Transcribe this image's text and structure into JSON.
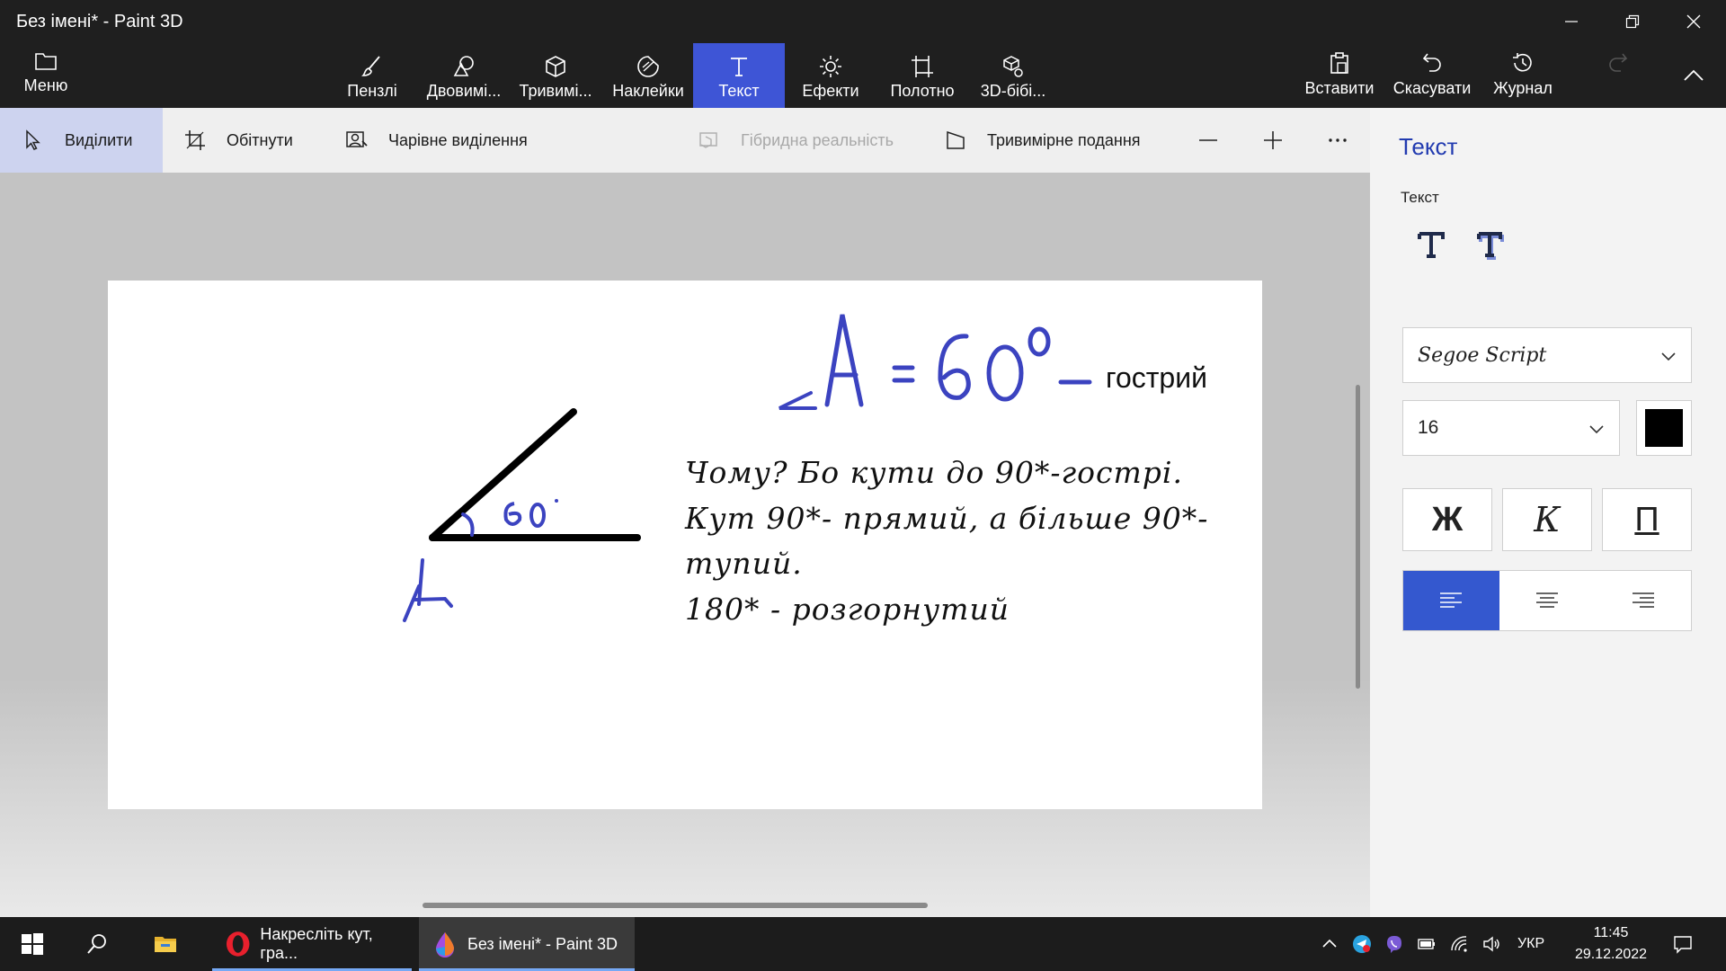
{
  "window": {
    "title": "Без імені* - Paint 3D"
  },
  "menu": {
    "label": "Меню"
  },
  "ribbon": {
    "tabs": [
      {
        "label": "Пензлі",
        "icon": "brush-icon"
      },
      {
        "label": "Двовимі...",
        "icon": "2d-shapes-icon"
      },
      {
        "label": "Тривимі...",
        "icon": "3d-shapes-icon"
      },
      {
        "label": "Наклейки",
        "icon": "stickers-icon"
      },
      {
        "label": "Текст",
        "icon": "text-icon",
        "active": true
      },
      {
        "label": "Ефекти",
        "icon": "effects-icon"
      },
      {
        "label": "Полотно",
        "icon": "canvas-icon"
      },
      {
        "label": "3D-бібі...",
        "icon": "3d-library-icon"
      }
    ],
    "actions": {
      "paste": "Вставити",
      "undo": "Скасувати",
      "history": "Журнал"
    }
  },
  "subtoolbar": {
    "select": "Виділити",
    "crop": "Обітнути",
    "magic_select": "Чарівне виділення",
    "mixed_reality": "Гібридна реальність",
    "view_3d": "Тривимірне подання"
  },
  "canvas": {
    "handwritten_formula": "∠A = 60°",
    "sharp_label": "гострий",
    "angle_label": "60°",
    "vertex_label": "A",
    "lines": [
      "Чому? Бо кути до 90*-гострі.",
      "Кут 90*- прямий, а більше 90*-",
      "тупий.",
      "180* - розгорнутий"
    ],
    "ink_color": "#3b43c0"
  },
  "panel": {
    "title": "Текст",
    "subtitle": "Текст",
    "font": "Segoe Script",
    "size": "16",
    "color": "#000000",
    "bold": "Ж",
    "italic": "К",
    "underline": "П",
    "align_selected": "left"
  },
  "taskbar": {
    "apps": [
      {
        "label": "Накресліть кут, гра...",
        "icon": "opera-icon"
      },
      {
        "label": "Без імені* - Paint 3D",
        "icon": "paint3d-icon",
        "active": true
      }
    ],
    "language": "УКР",
    "time": "11:45",
    "date": "29.12.2022"
  }
}
